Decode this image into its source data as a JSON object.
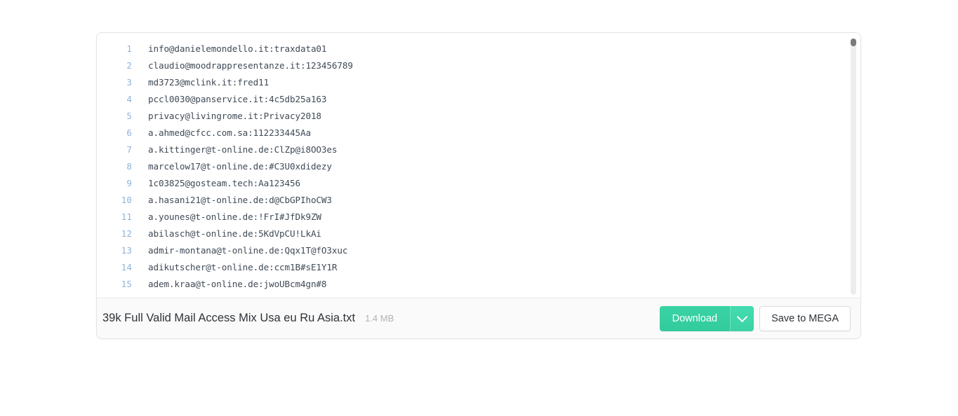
{
  "preview": {
    "code_lines": [
      {
        "n": "1",
        "text": "info@danielemondello.it:traxdata01"
      },
      {
        "n": "2",
        "text": "claudio@moodrappresentanze.it:123456789"
      },
      {
        "n": "3",
        "text": "md3723@mclink.it:fred11"
      },
      {
        "n": "4",
        "text": "pccl0030@panservice.it:4c5db25a163"
      },
      {
        "n": "5",
        "text": "privacy@livingrome.it:Privacy2018"
      },
      {
        "n": "6",
        "text": "a.ahmed@cfcc.com.sa:112233445Aa"
      },
      {
        "n": "7",
        "text": "a.kittinger@t-online.de:ClZp@i8OO3es"
      },
      {
        "n": "8",
        "text": "marcelow17@t-online.de:#C3U0xdidezy"
      },
      {
        "n": "9",
        "text": "1c03825@gosteam.tech:Aa123456"
      },
      {
        "n": "10",
        "text": "a.hasani21@t-online.de:d@CbGPIhoCW3"
      },
      {
        "n": "11",
        "text": "a.younes@t-online.de:!FrI#JfDk9ZW"
      },
      {
        "n": "12",
        "text": "abilasch@t-online.de:5KdVpCU!LkAi"
      },
      {
        "n": "13",
        "text": "admir-montana@t-online.de:Qqx1T@fO3xuc"
      },
      {
        "n": "14",
        "text": "adikutscher@t-online.de:ccm1B#sE1Y1R"
      },
      {
        "n": "15",
        "text": "adem.kraa@t-online.de:jwoUBcm4gn#8"
      }
    ]
  },
  "footer": {
    "file_name": "39k Full Valid Mail Access Mix Usa eu Ru Asia.txt",
    "file_size": "1.4 MB",
    "download_label": "Download",
    "download_caret_icon": "chevron-down-icon",
    "save_to_mega_label": "Save to MEGA"
  },
  "colors": {
    "accent_green": "#36cfa0",
    "accent_green_light": "#3fd8ab",
    "line_number": "#8fb3d9",
    "code_text": "#3f4a56",
    "footer_bg": "#fafafa",
    "border": "#e4e4e4",
    "file_size_text": "#b3b3b3"
  }
}
